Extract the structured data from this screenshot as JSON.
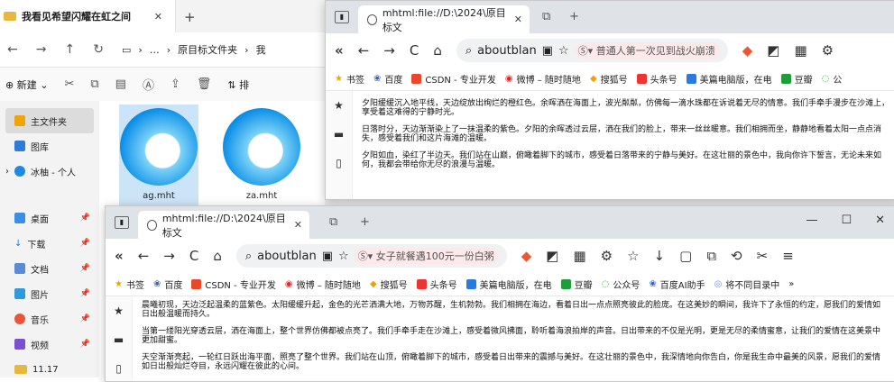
{
  "explorer": {
    "tab_title": "我看见希望闪耀在虹之间",
    "breadcrumb": [
      "原目标文件夹",
      "我"
    ],
    "new_label": "新建",
    "sort_label": "排",
    "sidebar": [
      {
        "label": "主文件夹",
        "color": "#f0a30a"
      },
      {
        "label": "图库",
        "color": "#2f7bd8"
      },
      {
        "label": "冰柚 - 个人",
        "color": "#1e88e5"
      },
      {
        "label": "桌面",
        "color": "#3a8ee6"
      },
      {
        "label": "下载",
        "color": "#1b7fd6"
      },
      {
        "label": "文档",
        "color": "#5b8bd6"
      },
      {
        "label": "图片",
        "color": "#2e9ad8"
      },
      {
        "label": "音乐",
        "color": "#e8553a"
      },
      {
        "label": "视频",
        "color": "#7a4fd6"
      },
      {
        "label": "11.17",
        "color": "#e8b73f"
      }
    ],
    "files": [
      "ag.mht",
      "za.mht"
    ]
  },
  "back_window": {
    "tab_title": "mhtml:file://D:\\2024\\原目标文",
    "address": "aboutblan",
    "search_text": "普通人第一次见到战火崩溃",
    "bookmarks": [
      "书签",
      "百度",
      "CSDN - 专业开发",
      "微博 – 随时随地",
      "搜狐号",
      "头条号",
      "美篇电脑版，在电",
      "豆瓣",
      "公"
    ],
    "paragraphs": [
      "夕阳缓缓沉入地平线，天边绽放出绚烂的橙红色。余晖洒在海面上，波光粼粼，仿佛每一滴水珠都在诉说着无尽的情意。我们手牵手漫步在沙滩上，享受着这难得的宁静时光。",
      "日落时分，天边渐渐染上了一抹温柔的紫色。夕阳的余晖透过云层，洒在我们的脸上，带来一丝丝暖意。我们相拥而坐，静静地看着太阳一点点消失，感受着我们和这片海滩的温暖。",
      "夕阳如血，染红了半边天。我们站在山巅，俯瞰着脚下的城市，感受着日落带来的宁静与美好。在这壮丽的景色中，我向你许下誓言，无论未来如何，我都会带给你无尽的浪漫与温暖。"
    ]
  },
  "front_window": {
    "tab_title": "mhtml:file://D:\\2024\\原目标文",
    "address": "aboutblan",
    "search_text": "女子就餐遇100元一份白粥",
    "bookmarks": [
      "书签",
      "百度",
      "CSDN - 专业开发",
      "微博 – 随时随地",
      "搜狐号",
      "头条号",
      "美篇电脑版，在电",
      "豆瓣",
      "公众号",
      "百度AI助手",
      "将不同目录中"
    ],
    "paragraphs": [
      "晨曦初现，天边泛起温柔的蓝紫色。太阳缓缓升起，金色的光芒洒满大地，万物苏醒，生机勃勃。我们相拥在海边，看着日出一点点照亮彼此的脸庞。在这美妙的瞬间，我许下了永恒的约定，愿我们的爱情如日出般温暖而持久。",
      "当第一缕阳光穿透云层，洒在海面上，整个世界仿佛都被点亮了。我们手牵手走在沙滩上，感受着微风拂面，聆听着海浪拍岸的声音。日出带来的不仅是光明，更是无尽的柔情蜜意，让我们的爱情在这美景中更加甜蜜。",
      "天空渐渐亮起，一轮红日跃出海平面，照亮了整个世界。我们站在山顶，俯瞰着脚下的城市，感受着日出带来的震撼与美好。在这壮丽的景色中，我深情地向你告白，你是我生命中最美的风景，愿我们的爱情如日出般灿烂夺目，永远闪耀在彼此的心间。"
    ]
  }
}
